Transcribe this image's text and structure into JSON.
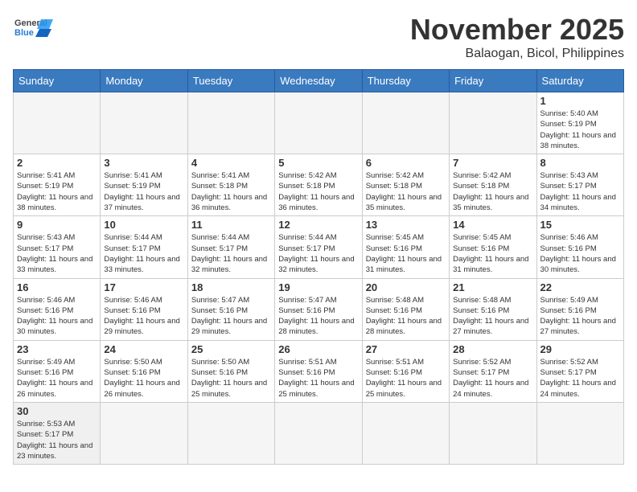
{
  "header": {
    "logo_general": "General",
    "logo_blue": "Blue",
    "month_title": "November 2025",
    "location": "Balaogan, Bicol, Philippines"
  },
  "weekdays": [
    "Sunday",
    "Monday",
    "Tuesday",
    "Wednesday",
    "Thursday",
    "Friday",
    "Saturday"
  ],
  "days": [
    {
      "date": "",
      "info": ""
    },
    {
      "date": "",
      "info": ""
    },
    {
      "date": "",
      "info": ""
    },
    {
      "date": "",
      "info": ""
    },
    {
      "date": "",
      "info": ""
    },
    {
      "date": "",
      "info": ""
    },
    {
      "date": "1",
      "sunrise": "Sunrise: 5:40 AM",
      "sunset": "Sunset: 5:19 PM",
      "daylight": "Daylight: 11 hours and 38 minutes."
    },
    {
      "date": "2",
      "sunrise": "Sunrise: 5:41 AM",
      "sunset": "Sunset: 5:19 PM",
      "daylight": "Daylight: 11 hours and 38 minutes."
    },
    {
      "date": "3",
      "sunrise": "Sunrise: 5:41 AM",
      "sunset": "Sunset: 5:19 PM",
      "daylight": "Daylight: 11 hours and 37 minutes."
    },
    {
      "date": "4",
      "sunrise": "Sunrise: 5:41 AM",
      "sunset": "Sunset: 5:18 PM",
      "daylight": "Daylight: 11 hours and 36 minutes."
    },
    {
      "date": "5",
      "sunrise": "Sunrise: 5:42 AM",
      "sunset": "Sunset: 5:18 PM",
      "daylight": "Daylight: 11 hours and 36 minutes."
    },
    {
      "date": "6",
      "sunrise": "Sunrise: 5:42 AM",
      "sunset": "Sunset: 5:18 PM",
      "daylight": "Daylight: 11 hours and 35 minutes."
    },
    {
      "date": "7",
      "sunrise": "Sunrise: 5:42 AM",
      "sunset": "Sunset: 5:18 PM",
      "daylight": "Daylight: 11 hours and 35 minutes."
    },
    {
      "date": "8",
      "sunrise": "Sunrise: 5:43 AM",
      "sunset": "Sunset: 5:17 PM",
      "daylight": "Daylight: 11 hours and 34 minutes."
    },
    {
      "date": "9",
      "sunrise": "Sunrise: 5:43 AM",
      "sunset": "Sunset: 5:17 PM",
      "daylight": "Daylight: 11 hours and 33 minutes."
    },
    {
      "date": "10",
      "sunrise": "Sunrise: 5:44 AM",
      "sunset": "Sunset: 5:17 PM",
      "daylight": "Daylight: 11 hours and 33 minutes."
    },
    {
      "date": "11",
      "sunrise": "Sunrise: 5:44 AM",
      "sunset": "Sunset: 5:17 PM",
      "daylight": "Daylight: 11 hours and 32 minutes."
    },
    {
      "date": "12",
      "sunrise": "Sunrise: 5:44 AM",
      "sunset": "Sunset: 5:17 PM",
      "daylight": "Daylight: 11 hours and 32 minutes."
    },
    {
      "date": "13",
      "sunrise": "Sunrise: 5:45 AM",
      "sunset": "Sunset: 5:16 PM",
      "daylight": "Daylight: 11 hours and 31 minutes."
    },
    {
      "date": "14",
      "sunrise": "Sunrise: 5:45 AM",
      "sunset": "Sunset: 5:16 PM",
      "daylight": "Daylight: 11 hours and 31 minutes."
    },
    {
      "date": "15",
      "sunrise": "Sunrise: 5:46 AM",
      "sunset": "Sunset: 5:16 PM",
      "daylight": "Daylight: 11 hours and 30 minutes."
    },
    {
      "date": "16",
      "sunrise": "Sunrise: 5:46 AM",
      "sunset": "Sunset: 5:16 PM",
      "daylight": "Daylight: 11 hours and 30 minutes."
    },
    {
      "date": "17",
      "sunrise": "Sunrise: 5:46 AM",
      "sunset": "Sunset: 5:16 PM",
      "daylight": "Daylight: 11 hours and 29 minutes."
    },
    {
      "date": "18",
      "sunrise": "Sunrise: 5:47 AM",
      "sunset": "Sunset: 5:16 PM",
      "daylight": "Daylight: 11 hours and 29 minutes."
    },
    {
      "date": "19",
      "sunrise": "Sunrise: 5:47 AM",
      "sunset": "Sunset: 5:16 PM",
      "daylight": "Daylight: 11 hours and 28 minutes."
    },
    {
      "date": "20",
      "sunrise": "Sunrise: 5:48 AM",
      "sunset": "Sunset: 5:16 PM",
      "daylight": "Daylight: 11 hours and 28 minutes."
    },
    {
      "date": "21",
      "sunrise": "Sunrise: 5:48 AM",
      "sunset": "Sunset: 5:16 PM",
      "daylight": "Daylight: 11 hours and 27 minutes."
    },
    {
      "date": "22",
      "sunrise": "Sunrise: 5:49 AM",
      "sunset": "Sunset: 5:16 PM",
      "daylight": "Daylight: 11 hours and 27 minutes."
    },
    {
      "date": "23",
      "sunrise": "Sunrise: 5:49 AM",
      "sunset": "Sunset: 5:16 PM",
      "daylight": "Daylight: 11 hours and 26 minutes."
    },
    {
      "date": "24",
      "sunrise": "Sunrise: 5:50 AM",
      "sunset": "Sunset: 5:16 PM",
      "daylight": "Daylight: 11 hours and 26 minutes."
    },
    {
      "date": "25",
      "sunrise": "Sunrise: 5:50 AM",
      "sunset": "Sunset: 5:16 PM",
      "daylight": "Daylight: 11 hours and 25 minutes."
    },
    {
      "date": "26",
      "sunrise": "Sunrise: 5:51 AM",
      "sunset": "Sunset: 5:16 PM",
      "daylight": "Daylight: 11 hours and 25 minutes."
    },
    {
      "date": "27",
      "sunrise": "Sunrise: 5:51 AM",
      "sunset": "Sunset: 5:16 PM",
      "daylight": "Daylight: 11 hours and 25 minutes."
    },
    {
      "date": "28",
      "sunrise": "Sunrise: 5:52 AM",
      "sunset": "Sunset: 5:17 PM",
      "daylight": "Daylight: 11 hours and 24 minutes."
    },
    {
      "date": "29",
      "sunrise": "Sunrise: 5:52 AM",
      "sunset": "Sunset: 5:17 PM",
      "daylight": "Daylight: 11 hours and 24 minutes."
    },
    {
      "date": "30",
      "sunrise": "Sunrise: 5:53 AM",
      "sunset": "Sunset: 5:17 PM",
      "daylight": "Daylight: 11 hours and 23 minutes."
    }
  ]
}
